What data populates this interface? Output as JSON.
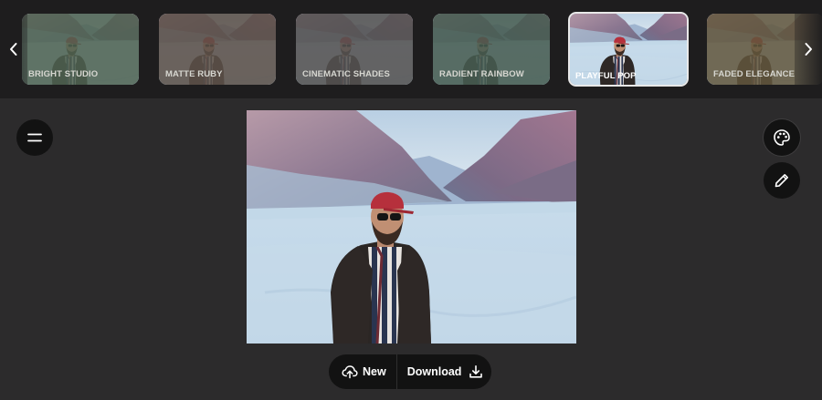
{
  "filters": [
    {
      "label": "BRIGHT STUDIO",
      "tint": "#66806a",
      "active": false
    },
    {
      "label": "MATTE RUBY",
      "tint": "#8a5a4e",
      "active": false
    },
    {
      "label": "CINEMATIC SHADES",
      "tint": "#6b6a66",
      "active": false
    },
    {
      "label": "RADIENT RAINBOW",
      "tint": "#5e7b6c",
      "active": false
    },
    {
      "label": "PLAYFUL POP",
      "tint": "#ffffff",
      "active": true
    },
    {
      "label": "FADED ELEGANCE",
      "tint": "#8a7a4a",
      "active": false
    }
  ],
  "strip": {
    "prev_icon": "chevron-left-icon",
    "next_icon": "chevron-right-icon"
  },
  "toolbar": {
    "menu_icon": "hamburger-menu-icon",
    "palette_icon": "palette-icon",
    "edit_icon": "pencil-icon"
  },
  "actions": {
    "new_label": "New",
    "new_icon": "cloud-upload-icon",
    "download_label": "Download",
    "download_icon": "download-icon"
  },
  "colors": {
    "background": "#2c2b2c",
    "strip_background": "#1e1d1e",
    "button_background": "#121212",
    "active_border": "#e9e9e9"
  }
}
